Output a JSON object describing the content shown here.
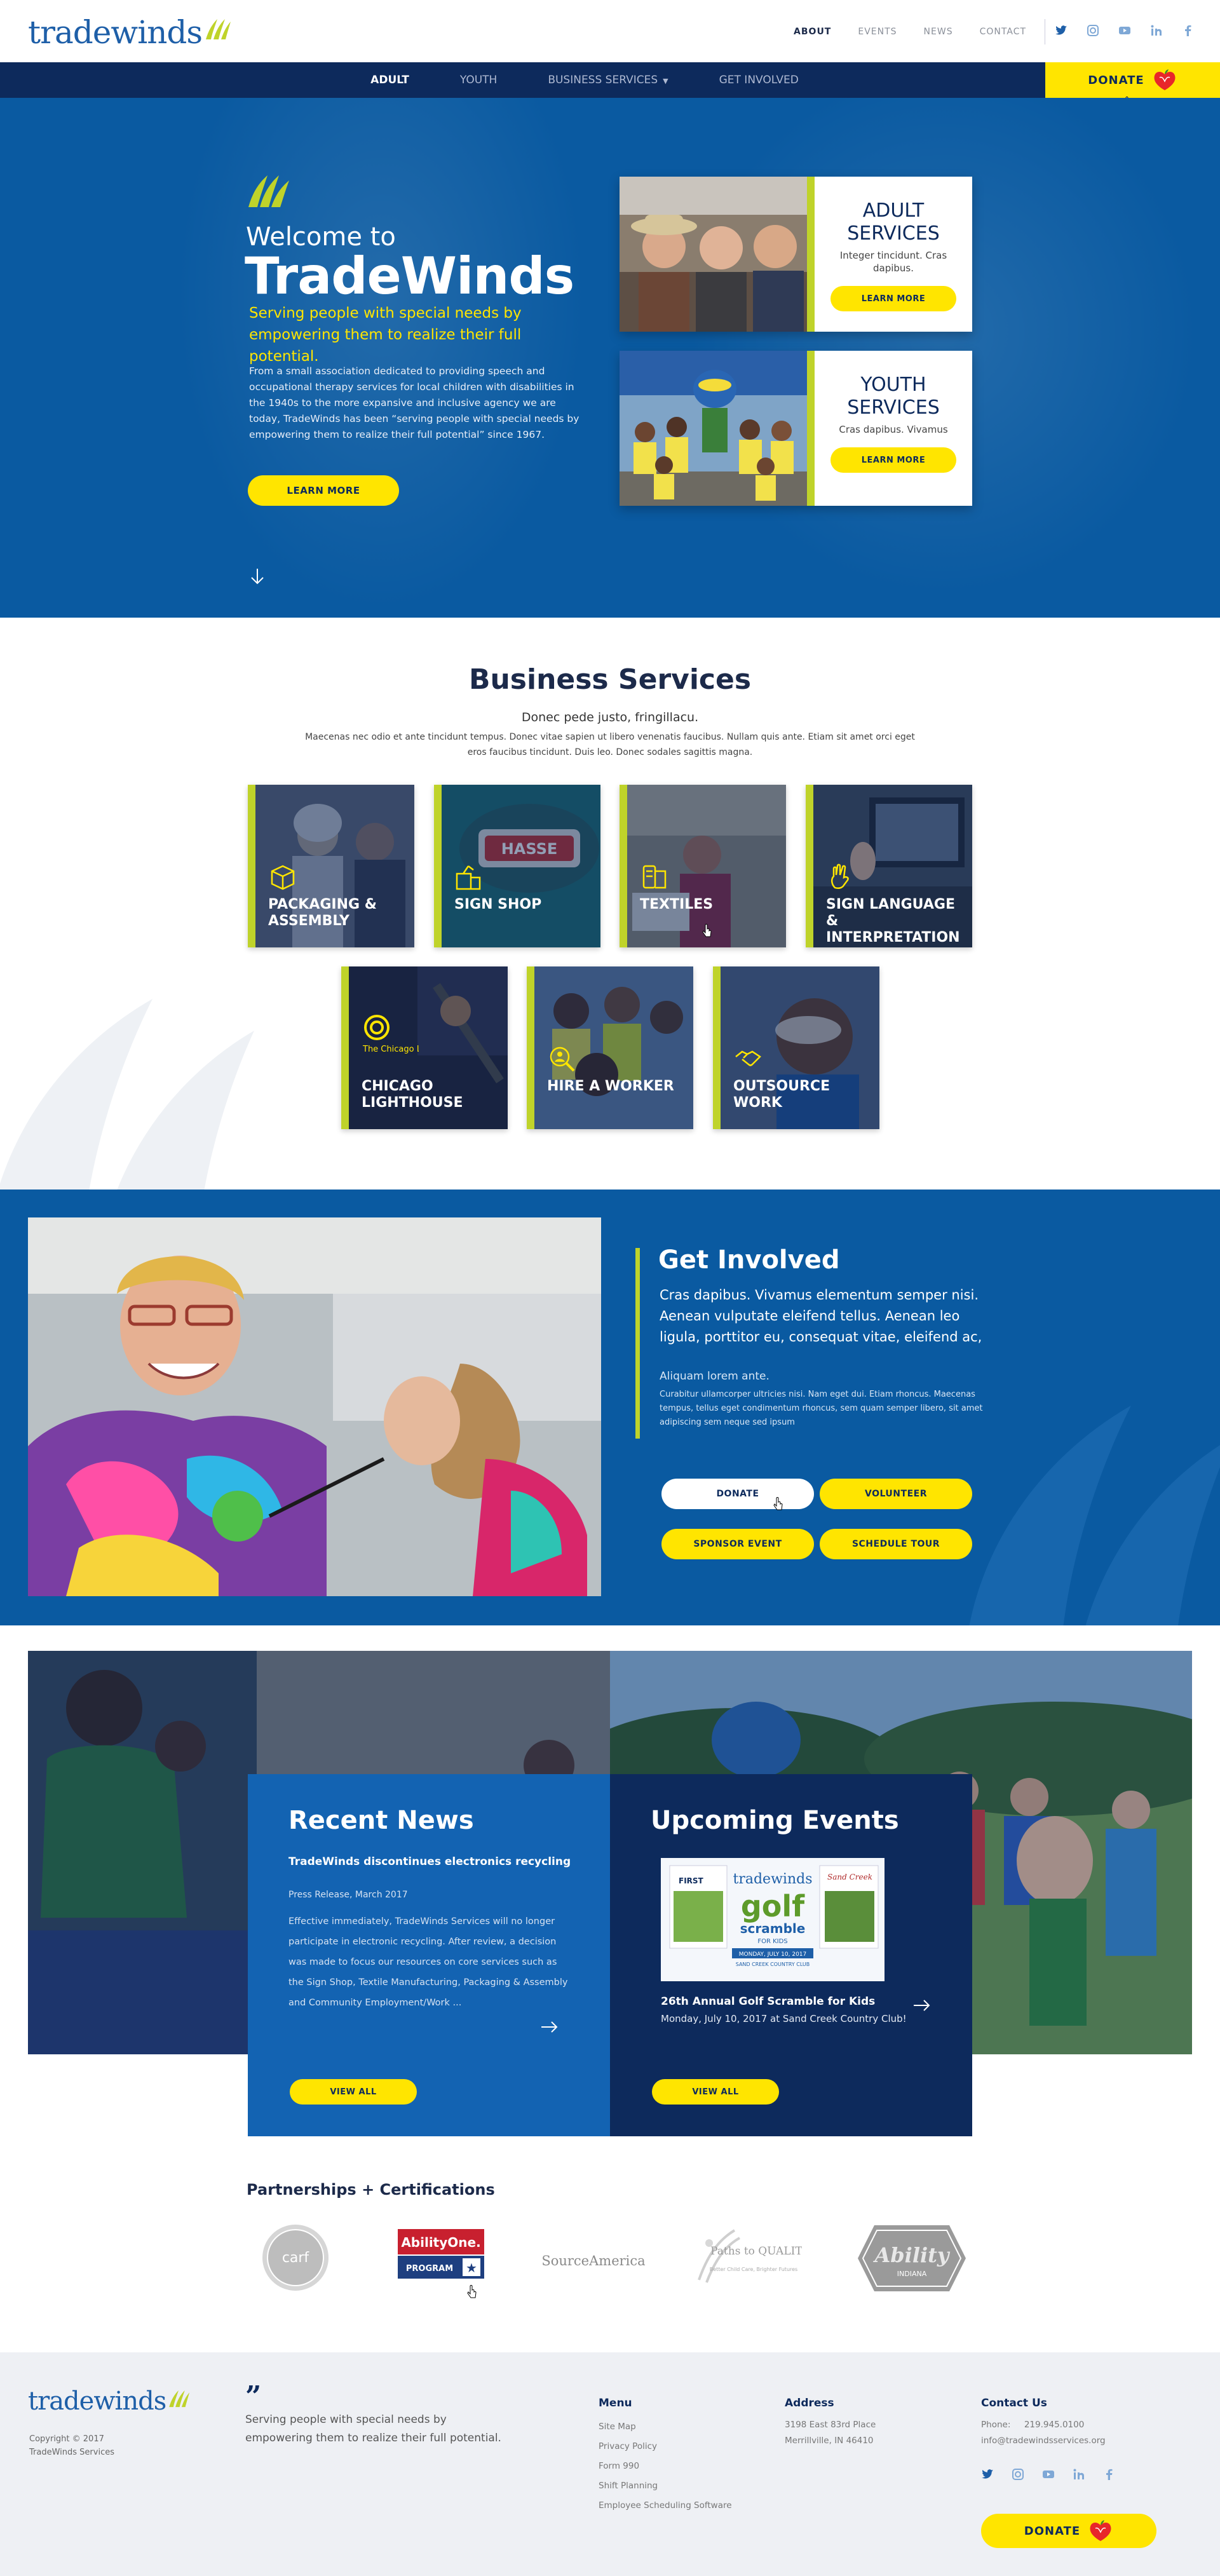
{
  "brand": {
    "name": "tradewinds",
    "green": "#bfd32a",
    "yellow": "#ffe500",
    "navy": "#0d2a5c",
    "blue": "#0a5aa1"
  },
  "top_links": [
    "ABOUT",
    "EVENTS",
    "NEWS",
    "CONTACT"
  ],
  "social_icons": [
    "twitter-icon",
    "instagram-icon",
    "youtube-icon",
    "linkedin-icon",
    "facebook-icon"
  ],
  "nav": {
    "items": [
      {
        "label": "ADULT",
        "active": true
      },
      {
        "label": "YOUTH",
        "active": false
      },
      {
        "label": "BUSINESS SERVICES",
        "active": false,
        "dropdown": true
      },
      {
        "label": "GET INVOLVED",
        "active": false
      }
    ],
    "donate": "DONATE"
  },
  "hero": {
    "welcome": "Welcome to",
    "title": "TradeWinds",
    "tagline": "Serving people with special needs by empowering them to realize their full potential.",
    "body": "From a small association dedicated to providing speech and occupational therapy services for local children with disabilities in the 1940s to the more expansive and inclusive agency we are today, TradeWinds has been “serving people with special needs by empowering them to realize their full potential” since 1967.",
    "button": "LEARN MORE"
  },
  "service_cards": [
    {
      "title": "ADULT SERVICES",
      "desc": "Integer tincidunt. Cras dapibus.",
      "button": "LEARN MORE"
    },
    {
      "title": "YOUTH SERVICES",
      "desc": "Cras dapibus. Vivamus",
      "button": "LEARN MORE"
    }
  ],
  "business": {
    "title": "Business Services",
    "subtitle": "Donec pede justo, fringillacu.",
    "body": "Maecenas nec odio et ante tincidunt tempus. Donec vitae sapien ut libero venenatis faucibus. Nullam quis ante. Etiam sit amet orci eget eros faucibus tincidunt. Duis leo. Donec sodales sagittis magna.",
    "tiles": [
      {
        "label": "PACKAGING & ASSEMBLY",
        "icon": "box-icon"
      },
      {
        "label": "SIGN SHOP",
        "icon": "sign-icon"
      },
      {
        "label": "TEXTILES",
        "icon": "textile-icon"
      },
      {
        "label": "SIGN LANGUAGE & INTERPRETATION",
        "icon": "hand-icon"
      },
      {
        "label": "CHICAGO LIGHTHOUSE",
        "icon": "lighthouse-logo-icon",
        "logo_text": "The Chicago Lighthouse"
      },
      {
        "label": "HIRE A WORKER",
        "icon": "person-search-icon"
      },
      {
        "label": "OUTSOURCE WORK",
        "icon": "handshake-icon"
      }
    ]
  },
  "get_involved": {
    "title": "Get Involved",
    "lead": "Cras dapibus. Vivamus elementum semper nisi. Aenean vulputate eleifend tellus. Aenean leo ligula, porttitor eu, consequat vitae, eleifend ac,",
    "small_heading": "Aliquam lorem ante.",
    "small_body": "Curabitur ullamcorper ultricies nisi. Nam eget dui. Etiam rhoncus. Maecenas tempus, tellus eget condimentum rhoncus, sem quam semper libero, sit amet adipiscing sem neque sed ipsum",
    "buttons": [
      "DONATE",
      "VOLUNTEER",
      "SPONSOR EVENT",
      "SCHEDULE TOUR"
    ]
  },
  "news": {
    "title": "Recent News",
    "headline": "TradeWinds discontinues electronics  recycling",
    "meta": "Press Release, March 2017",
    "body": "Effective immediately, TradeWinds Services will no longer participate in electronic recycling. After review, a decision was made to focus our resources on core services such as the Sign Shop, Textile Manufacturing, Packaging & Assembly and Community Employment/Work ...",
    "button": "VIEW ALL"
  },
  "events": {
    "title": "Upcoming Events",
    "image_text": {
      "brand": "tradewinds",
      "word": "golf",
      "sub": "scramble",
      "kids": "FOR KIDS",
      "date": "MONDAY, JULY 10, 2017",
      "place": "SAND CREEK COUNTRY CLUB",
      "first": "FIRST",
      "sand": "Sand Creek"
    },
    "event_title": "26th Annual Golf Scramble for Kids",
    "event_date": "Monday, July 10, 2017 at Sand Creek Country Club!",
    "button": "VIEW ALL"
  },
  "partners": {
    "title": "Partnerships + Certifications",
    "logos": [
      {
        "name": "carf",
        "text": "carf"
      },
      {
        "name": "abilityone",
        "text": "AbilityOne.",
        "sub": "PROGRAM"
      },
      {
        "name": "sourceamerica",
        "text": "SourceAmerica"
      },
      {
        "name": "paths-to-quality",
        "text": "Paths to QUALITY",
        "sub": "Better Child Care, Brighter Futures"
      },
      {
        "name": "ability-indiana",
        "text": "Ability",
        "sub": "INDIANA"
      }
    ]
  },
  "footer": {
    "copyright": [
      "Copyright © 2017",
      "TradeWinds Services"
    ],
    "quote": "Serving people with special needs by empowering them to realize their full potential.",
    "menu": {
      "heading": "Menu",
      "items": [
        "Site Map",
        "Privacy Policy",
        "Form 990",
        "Shift Planning",
        "Employee Scheduling Software"
      ]
    },
    "address": {
      "heading": "Address",
      "lines": [
        "3198 East 83rd Place",
        "Merrillville, IN 46410"
      ]
    },
    "contact": {
      "heading": "Contact Us",
      "phone_label": "Phone:",
      "phone": "219.945.0100",
      "email": "info@tradewindsservices.org"
    },
    "donate": "DONATE"
  }
}
